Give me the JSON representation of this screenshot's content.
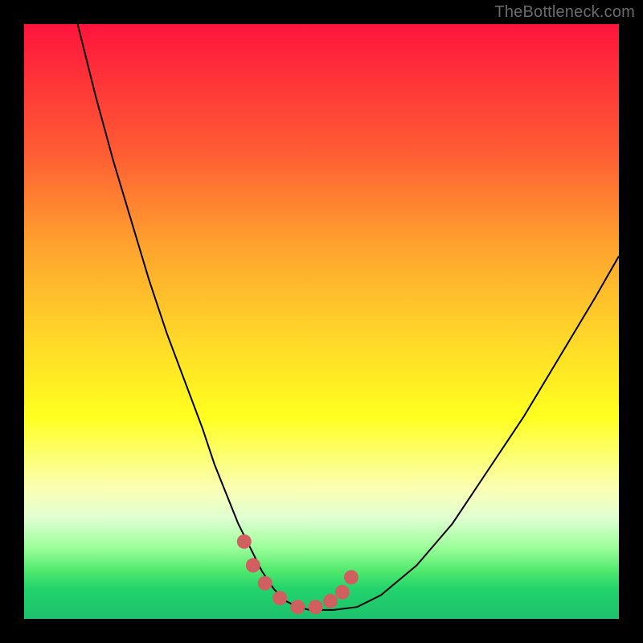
{
  "watermark": {
    "text": "TheBottleneck.com"
  },
  "chart_data": {
    "type": "line",
    "title": "",
    "xlabel": "",
    "ylabel": "",
    "xlim": [
      0,
      100
    ],
    "ylim": [
      0,
      100
    ],
    "grid": false,
    "legend": false,
    "background": {
      "gradient_stops": [
        {
          "pos": 0.0,
          "color": "#ff143c"
        },
        {
          "pos": 0.22,
          "color": "#ff5e33"
        },
        {
          "pos": 0.37,
          "color": "#ffa22e"
        },
        {
          "pos": 0.53,
          "color": "#ffd829"
        },
        {
          "pos": 0.66,
          "color": "#ffff1f"
        },
        {
          "pos": 0.78,
          "color": "#fbffb3"
        },
        {
          "pos": 0.83,
          "color": "#e0ffd2"
        },
        {
          "pos": 0.88,
          "color": "#9cff9a"
        },
        {
          "pos": 0.92,
          "color": "#4fe86d"
        },
        {
          "pos": 0.95,
          "color": "#22d36b"
        },
        {
          "pos": 1.0,
          "color": "#1cc06c"
        }
      ]
    },
    "series": [
      {
        "name": "bottleneck-curve",
        "stroke": "#000000",
        "stroke_width": 2,
        "x": [
          9,
          12,
          15,
          18,
          21,
          24,
          27,
          30,
          32,
          34,
          36,
          38,
          40,
          42,
          44,
          46,
          48,
          52,
          56,
          60,
          66,
          72,
          78,
          84,
          90,
          96,
          100
        ],
        "values": [
          100,
          88,
          77,
          67,
          57,
          48,
          40,
          32,
          26,
          21,
          16,
          12,
          8,
          5,
          3,
          2,
          1.5,
          1.5,
          2,
          4,
          9,
          16,
          25,
          34,
          44,
          54,
          61
        ]
      },
      {
        "name": "highlight-points",
        "type": "scatter",
        "color": "#d06060",
        "radius": 9,
        "x": [
          37,
          38.5,
          40.5,
          43,
          46,
          49,
          51.5,
          53.5,
          55
        ],
        "values": [
          13,
          9,
          6,
          3.5,
          2,
          2,
          3,
          4.5,
          7
        ]
      }
    ]
  }
}
